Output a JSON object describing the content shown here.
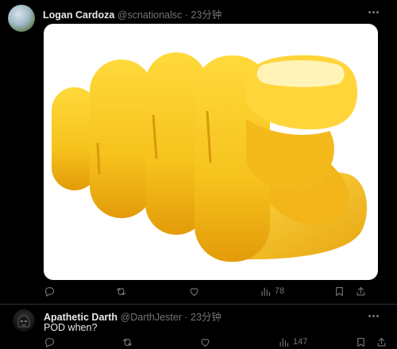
{
  "tweets": [
    {
      "author": "Logan Cardoza",
      "handle": "@scnationalsc",
      "separator": "·",
      "time": "23分钟",
      "text": "",
      "media": "pointing-finger-emoji",
      "stats": {
        "replies": "",
        "reposts": "",
        "likes": "",
        "views": "78"
      }
    },
    {
      "author": "Apathetic Darth",
      "handle": "@DarthJester",
      "separator": "·",
      "time": "23分钟",
      "text": "POD when?",
      "stats": {
        "replies": "",
        "reposts": "",
        "likes": "",
        "views": "147"
      }
    }
  ],
  "icons": {
    "reply": "reply-icon",
    "repost": "repost-icon",
    "like": "like-icon",
    "views": "views-icon",
    "bookmark": "bookmark-icon",
    "share": "share-icon",
    "more": "more-icon"
  },
  "colors": {
    "background": "#000000",
    "text": "#e7e9ea",
    "muted": "#71767b",
    "emoji_yellow": "#f6c21c",
    "emoji_orange": "#e39b0a"
  }
}
